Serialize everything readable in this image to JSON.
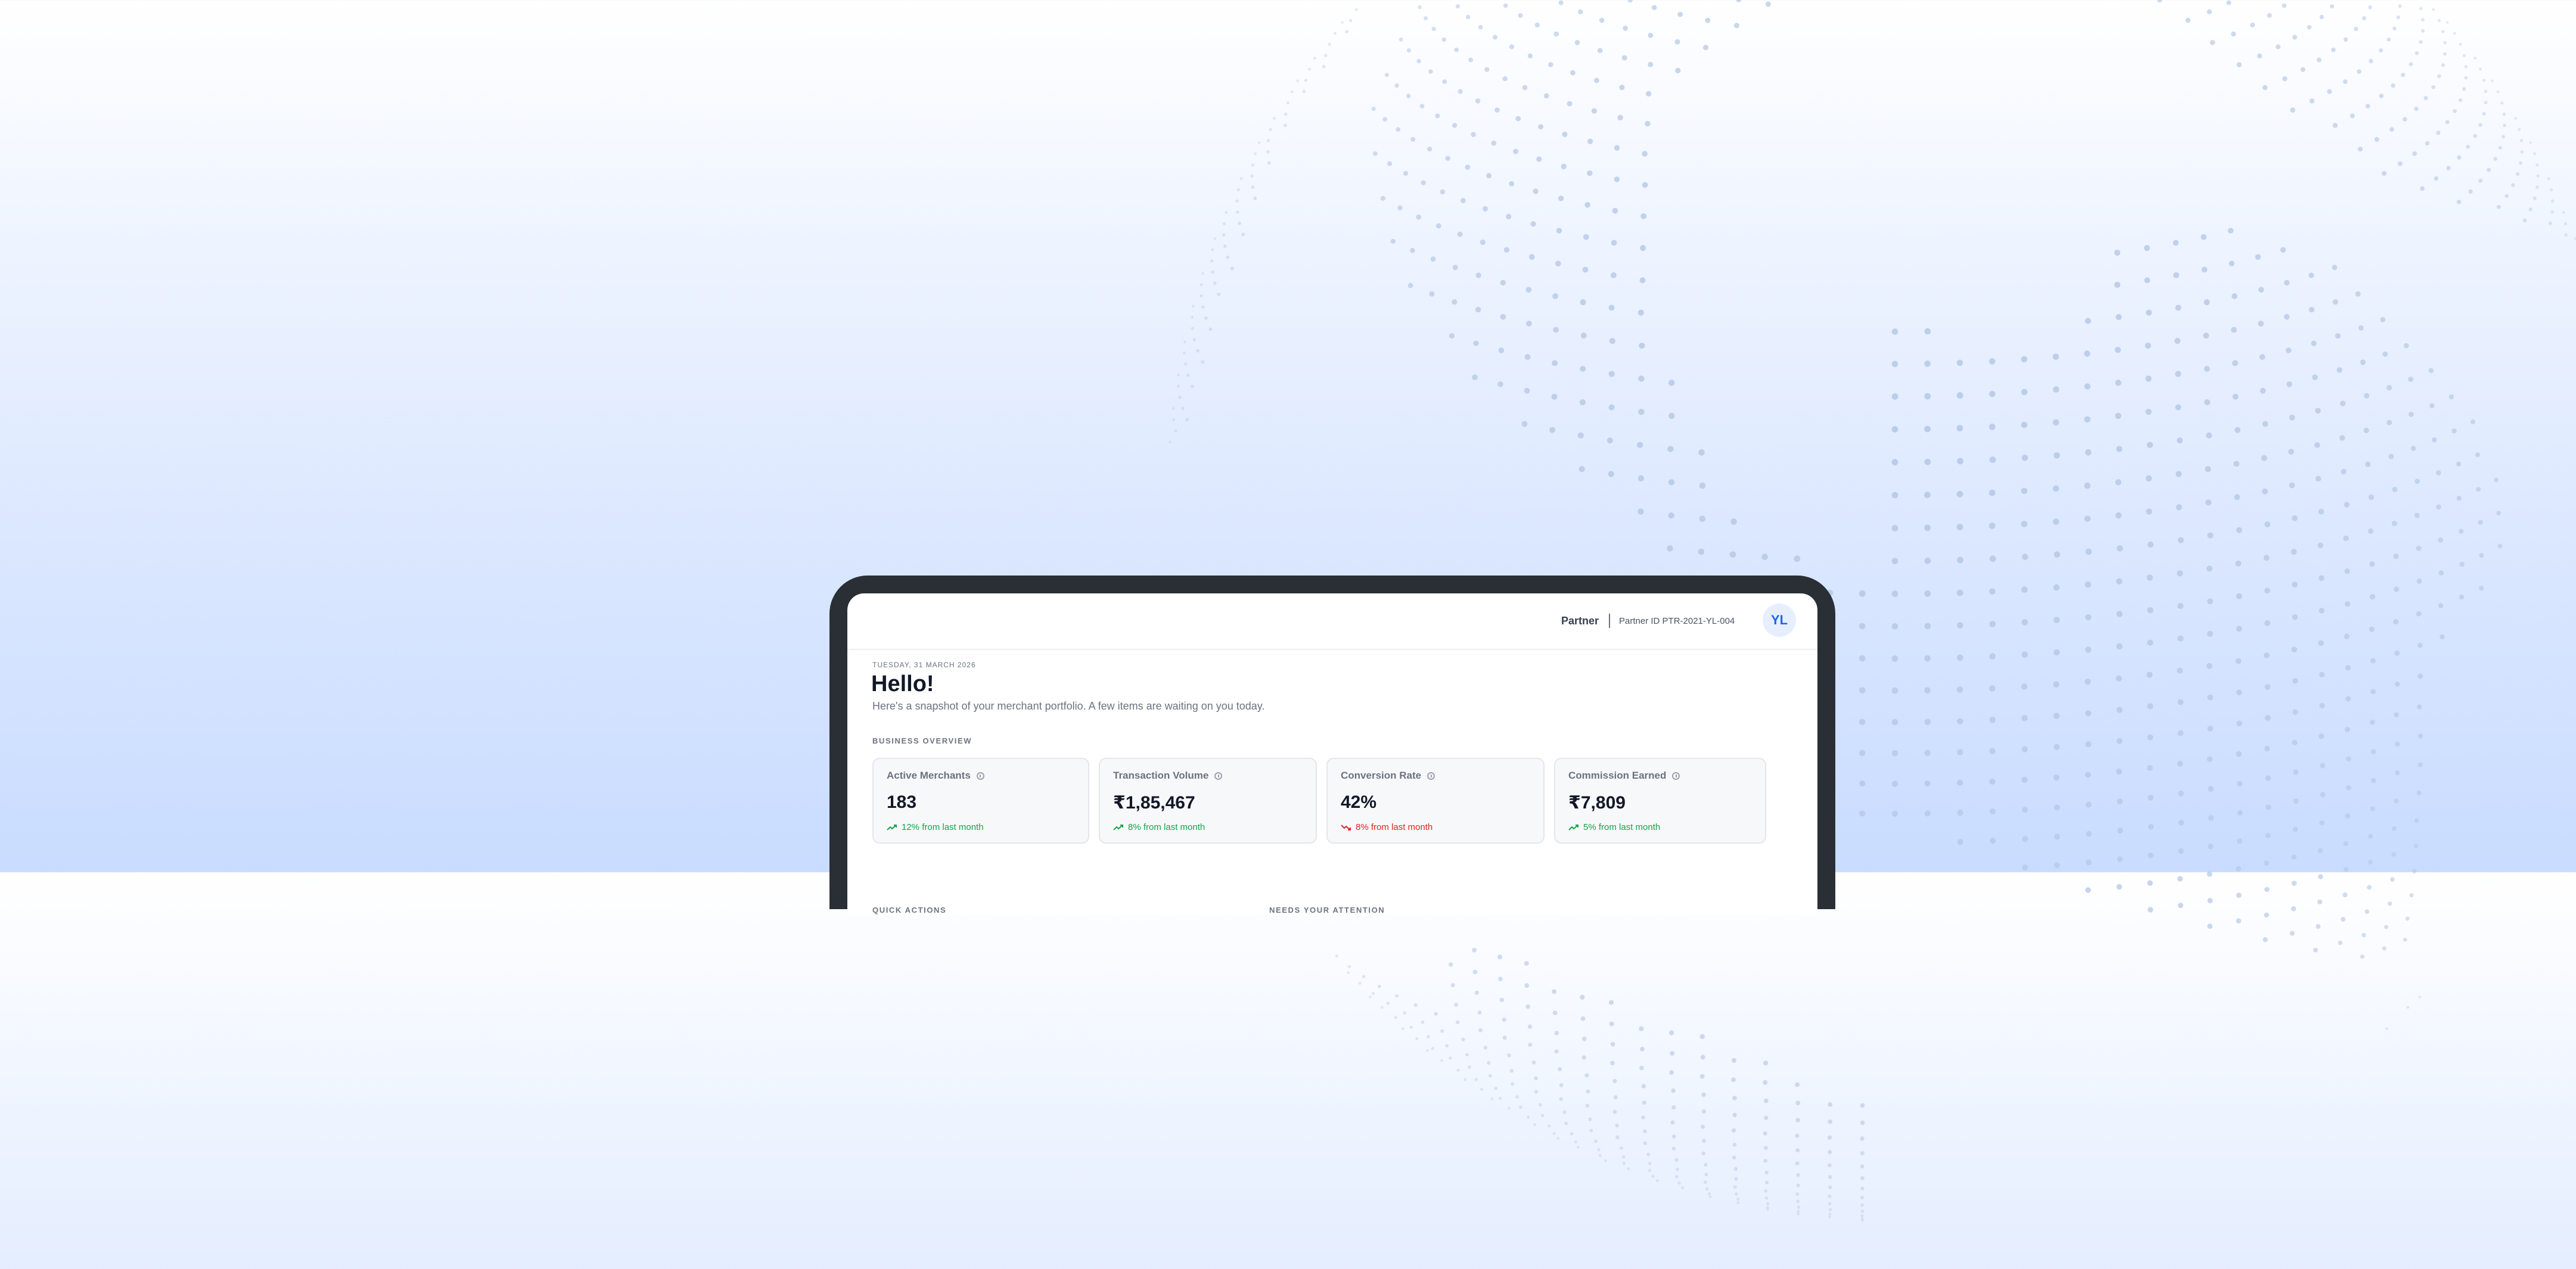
{
  "header": {
    "role": "Partner",
    "partner_id": "Partner ID PTR-2021-YL-004",
    "avatar_initials": "YL"
  },
  "greeting": {
    "date": "TUESDAY, 31 MARCH 2026",
    "title": "Hello!",
    "subtitle": "Here's a snapshot of your merchant portfolio. A few items are waiting on you today."
  },
  "business_overview": {
    "label": "BUSINESS OVERVIEW",
    "cards": [
      {
        "title": "Active Merchants",
        "value": "183",
        "delta": "12% from last month",
        "trend": "up"
      },
      {
        "title": "Transaction Volume",
        "value": "₹1,85,467",
        "delta": "8% from last month",
        "trend": "up"
      },
      {
        "title": "Conversion Rate",
        "value": "42%",
        "delta": "8% from last month",
        "trend": "down"
      },
      {
        "title": "Commission Earned",
        "value": "₹7,809",
        "delta": "5% from last month",
        "trend": "up"
      }
    ]
  },
  "sections": {
    "quick_actions": "QUICK ACTIONS",
    "needs_attention": "NEEDS YOUR ATTENTION"
  },
  "colors": {
    "accent": "#2563eb",
    "positive": "#16a34a",
    "negative": "#dc2626",
    "frame": "#2a2e35"
  },
  "icons": [
    "info-icon",
    "trend-up-icon",
    "trend-down-icon",
    "globe-dots"
  ]
}
